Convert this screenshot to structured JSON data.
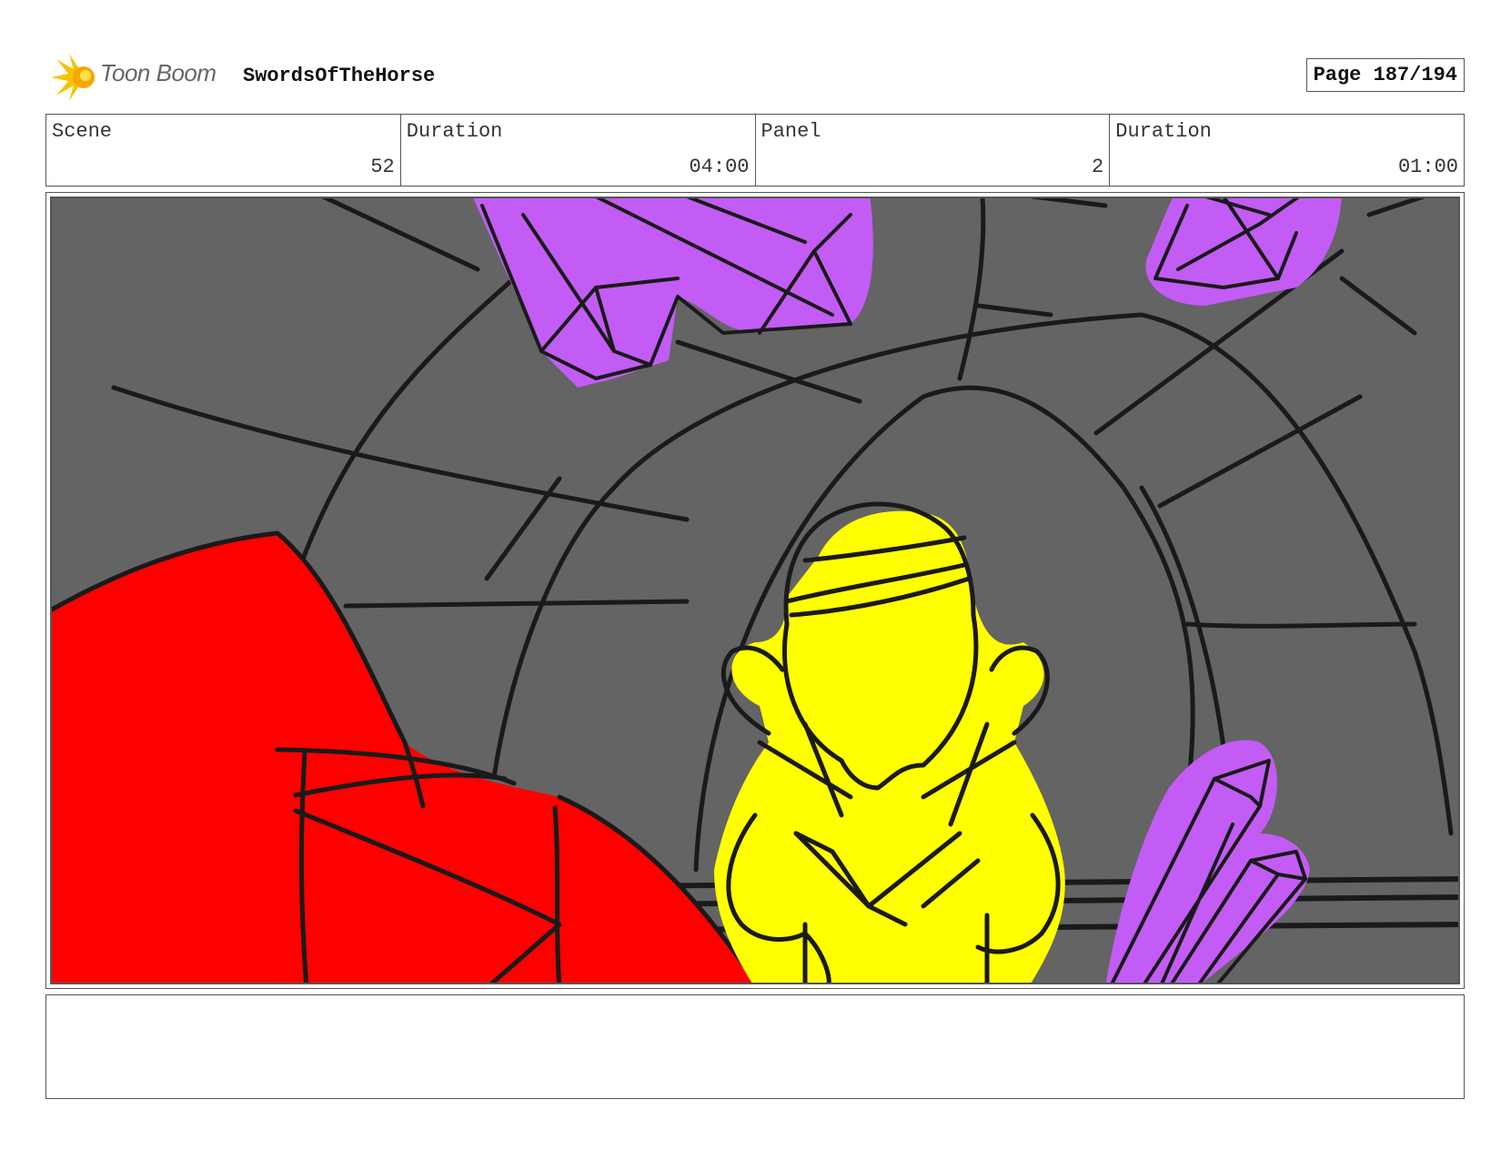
{
  "header": {
    "logo_text": "Toon Boom",
    "project_title": "SwordsOfTheHorse",
    "page_label": "Page 187/194"
  },
  "info": [
    {
      "label": "Scene",
      "value": "52"
    },
    {
      "label": "Duration",
      "value": "04:00"
    },
    {
      "label": "Panel",
      "value": "2"
    },
    {
      "label": "Duration",
      "value": "01:00"
    }
  ],
  "colors": {
    "background_wall": "#646464",
    "cloak_red": "#ff0000",
    "figure_yellow": "#ffff00",
    "crystal_purple": "#c35cf5",
    "line": "#1a1a1a",
    "logo_yellow": "#f5c400"
  },
  "notes": ""
}
